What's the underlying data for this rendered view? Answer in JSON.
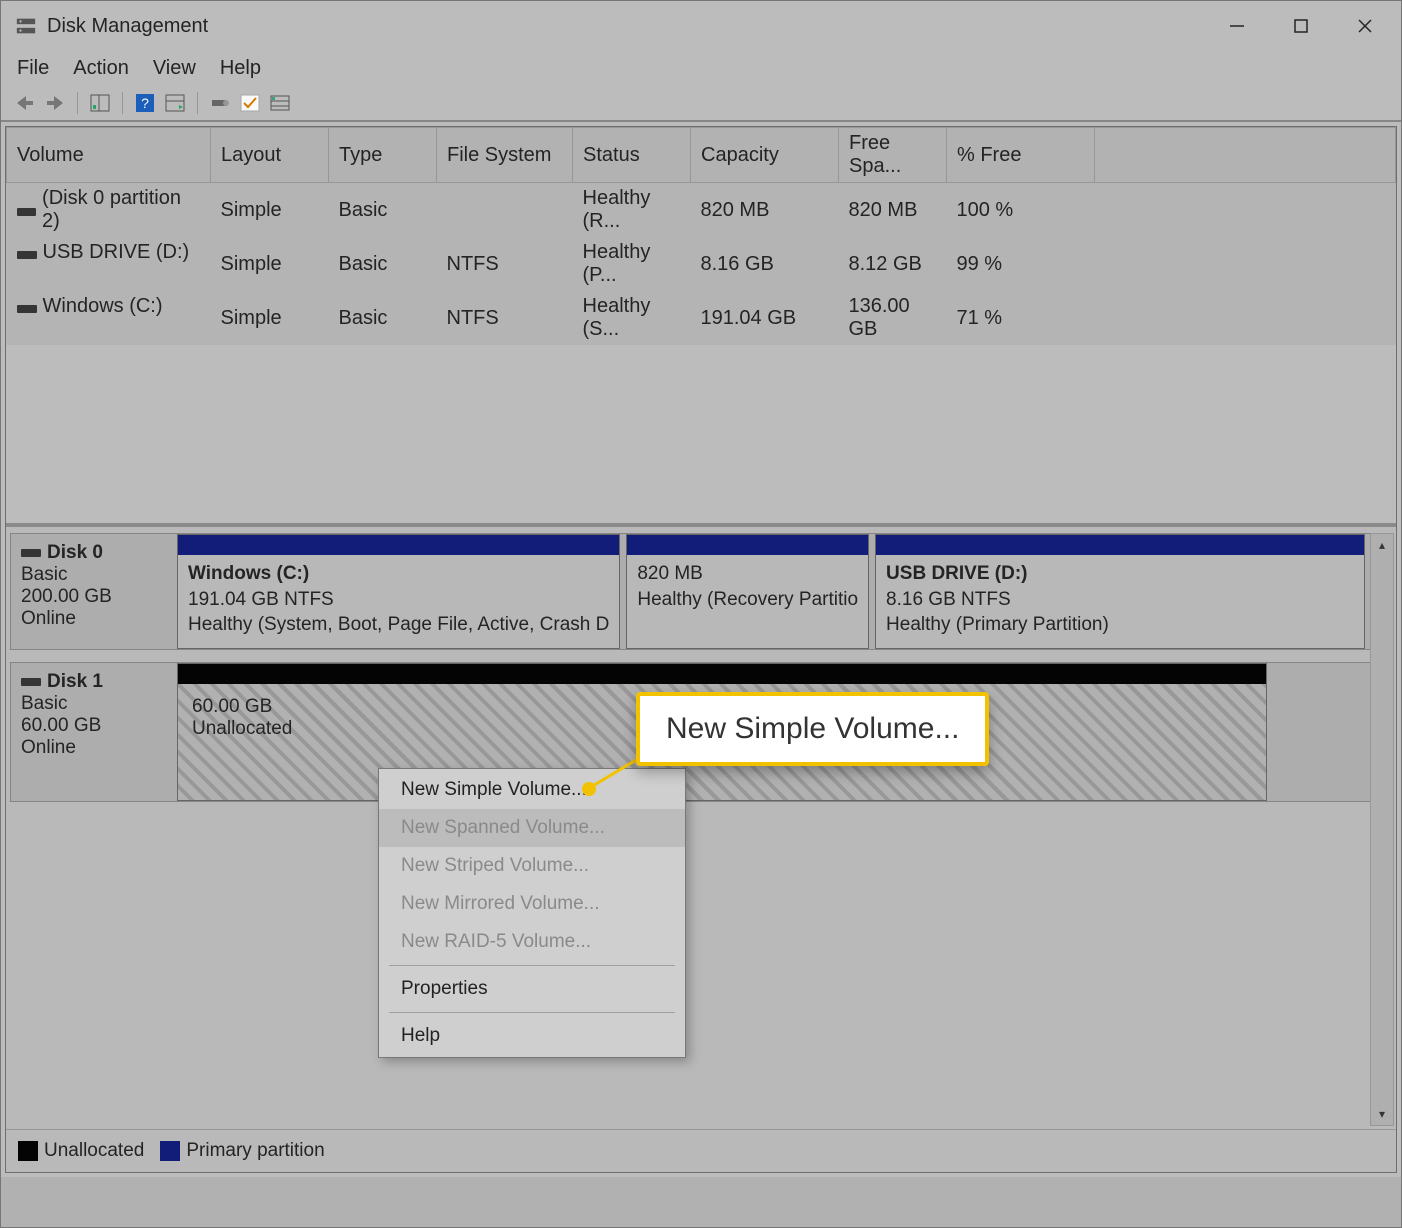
{
  "titlebar": {
    "title": "Disk Management"
  },
  "menu": {
    "file": "File",
    "action": "Action",
    "view": "View",
    "help": "Help"
  },
  "columns": {
    "volume": "Volume",
    "layout": "Layout",
    "type": "Type",
    "fs": "File System",
    "status": "Status",
    "capacity": "Capacity",
    "free": "Free Spa...",
    "pct": "% Free"
  },
  "rows": [
    {
      "volume": "(Disk 0 partition 2)",
      "layout": "Simple",
      "type": "Basic",
      "fs": "",
      "status": "Healthy (R...",
      "capacity": "820 MB",
      "free": "820 MB",
      "pct": "100 %"
    },
    {
      "volume": "USB DRIVE (D:)",
      "layout": "Simple",
      "type": "Basic",
      "fs": "NTFS",
      "status": "Healthy (P...",
      "capacity": "8.16 GB",
      "free": "8.12 GB",
      "pct": "99 %"
    },
    {
      "volume": "Windows (C:)",
      "layout": "Simple",
      "type": "Basic",
      "fs": "NTFS",
      "status": "Healthy (S...",
      "capacity": "191.04 GB",
      "free": "136.00 GB",
      "pct": "71 %"
    }
  ],
  "disks": [
    {
      "name": "Disk 0",
      "type": "Basic",
      "size": "200.00 GB",
      "state": "Online",
      "partitions": [
        {
          "title": "Windows  (C:)",
          "line2": "191.04 GB NTFS",
          "line3": "Healthy (System, Boot, Page File, Active, Crash D"
        },
        {
          "title": "",
          "line2": "820 MB",
          "line3": "Healthy (Recovery Partitio"
        },
        {
          "title": "USB DRIVE  (D:)",
          "line2": "8.16 GB NTFS",
          "line3": "Healthy (Primary Partition)"
        }
      ]
    },
    {
      "name": "Disk 1",
      "type": "Basic",
      "size": "60.00 GB",
      "state": "Online",
      "unallocated": {
        "line1": "60.00 GB",
        "line2": "Unallocated"
      }
    }
  ],
  "legend": {
    "unalloc": "Unallocated",
    "primary": "Primary partition"
  },
  "context": {
    "new_simple": "New Simple Volume...",
    "new_spanned": "New Spanned Volume...",
    "new_striped": "New Striped Volume...",
    "new_mirrored": "New Mirrored Volume...",
    "new_raid5": "New RAID-5 Volume...",
    "properties": "Properties",
    "help": "Help"
  },
  "callout": {
    "text": "New Simple Volume..."
  },
  "colors": {
    "primary_header": "#0f1a7a",
    "unalloc_header": "#000000",
    "highlight": "#f2c200"
  }
}
